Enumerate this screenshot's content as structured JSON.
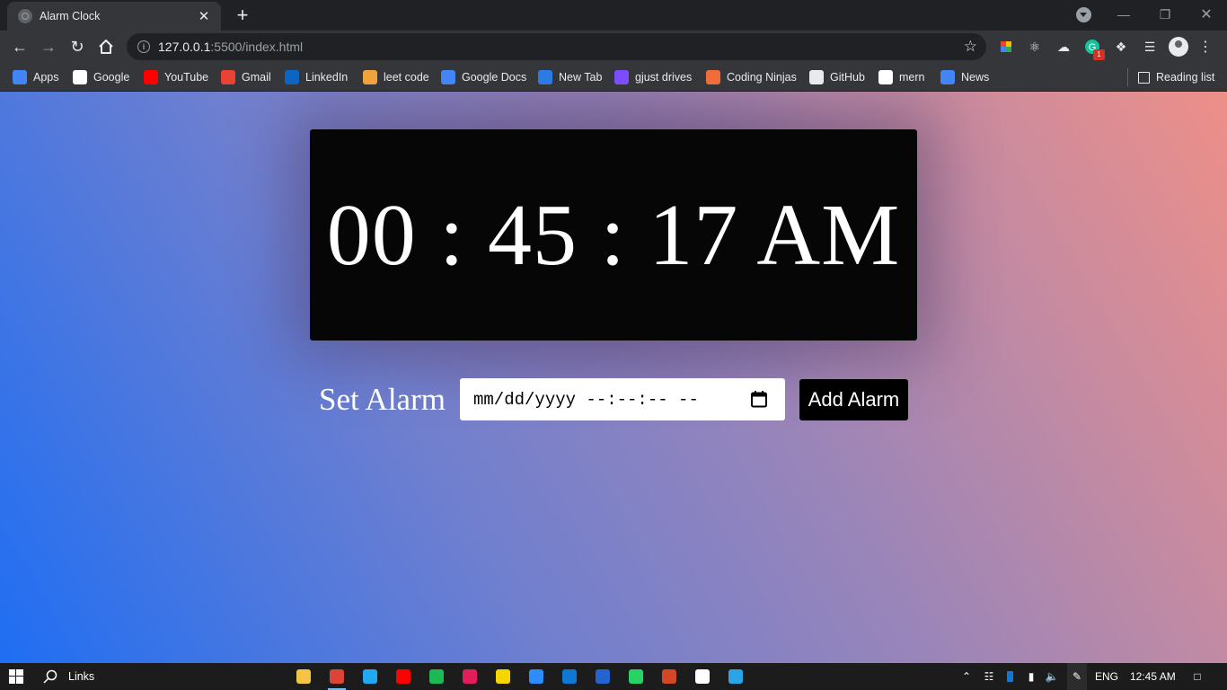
{
  "browser": {
    "tab_title": "Alarm Clock",
    "close_glyph": "✕",
    "new_tab_glyph": "+",
    "url_host": "127.0.0.1",
    "url_path": ":5500/index.html"
  },
  "bookmarks": [
    {
      "label": "Apps",
      "icon": "apps-grid-icon",
      "color": "#4285f4"
    },
    {
      "label": "Google",
      "icon": "google-icon",
      "color": "#ffffff"
    },
    {
      "label": "YouTube",
      "icon": "youtube-icon",
      "color": "#ff0000"
    },
    {
      "label": "Gmail",
      "icon": "gmail-icon",
      "color": "#ea4335"
    },
    {
      "label": "LinkedIn",
      "icon": "linkedin-icon",
      "color": "#0a66c2"
    },
    {
      "label": "leet code",
      "icon": "leetcode-icon",
      "color": "#f0a23c"
    },
    {
      "label": "Google Docs",
      "icon": "google-docs-icon",
      "color": "#4285f4"
    },
    {
      "label": "New Tab",
      "icon": "new-tab-icon",
      "color": "#2c7be5"
    },
    {
      "label": "gjust drives",
      "icon": "list-icon",
      "color": "#7c4dff"
    },
    {
      "label": "Coding Ninjas",
      "icon": "coding-ninjas-icon",
      "color": "#f26b3a"
    },
    {
      "label": "GitHub",
      "icon": "github-icon",
      "color": "#e8eaed"
    },
    {
      "label": "mern",
      "icon": "medium-icon",
      "color": "#ffffff"
    },
    {
      "label": "News",
      "icon": "news-icon",
      "color": "#4285f4"
    }
  ],
  "reading_list": "Reading list",
  "clock": {
    "time": "00 : 45 : 17 AM"
  },
  "alarm": {
    "label": "Set Alarm",
    "input_placeholder": "mm/dd/yyyy --:--:-- --",
    "button_label": "Add Alarm"
  },
  "taskbar": {
    "search_label": "Links",
    "language": "ENG",
    "time": "12:45 AM",
    "apps": [
      {
        "name": "file-explorer-icon",
        "color": "#f4c542"
      },
      {
        "name": "chrome-icon",
        "color": "#db4437",
        "active": true
      },
      {
        "name": "vscode-icon",
        "color": "#23a9f2"
      },
      {
        "name": "youtube-music-icon",
        "color": "#ff0000"
      },
      {
        "name": "spotify-icon",
        "color": "#1db954"
      },
      {
        "name": "slack-icon",
        "color": "#e01e5a"
      },
      {
        "name": "sticky-notes-icon",
        "color": "#f7d600"
      },
      {
        "name": "messenger-icon",
        "color": "#2d8cff"
      },
      {
        "name": "mail-icon",
        "color": "#0f78d4"
      },
      {
        "name": "todo-icon",
        "color": "#2564cf"
      },
      {
        "name": "whatsapp-icon",
        "color": "#25d366"
      },
      {
        "name": "snipping-icon",
        "color": "#d24726"
      },
      {
        "name": "intellij-icon",
        "color": "#ffffff"
      },
      {
        "name": "edge-icon",
        "color": "#2aa4e5"
      }
    ]
  }
}
